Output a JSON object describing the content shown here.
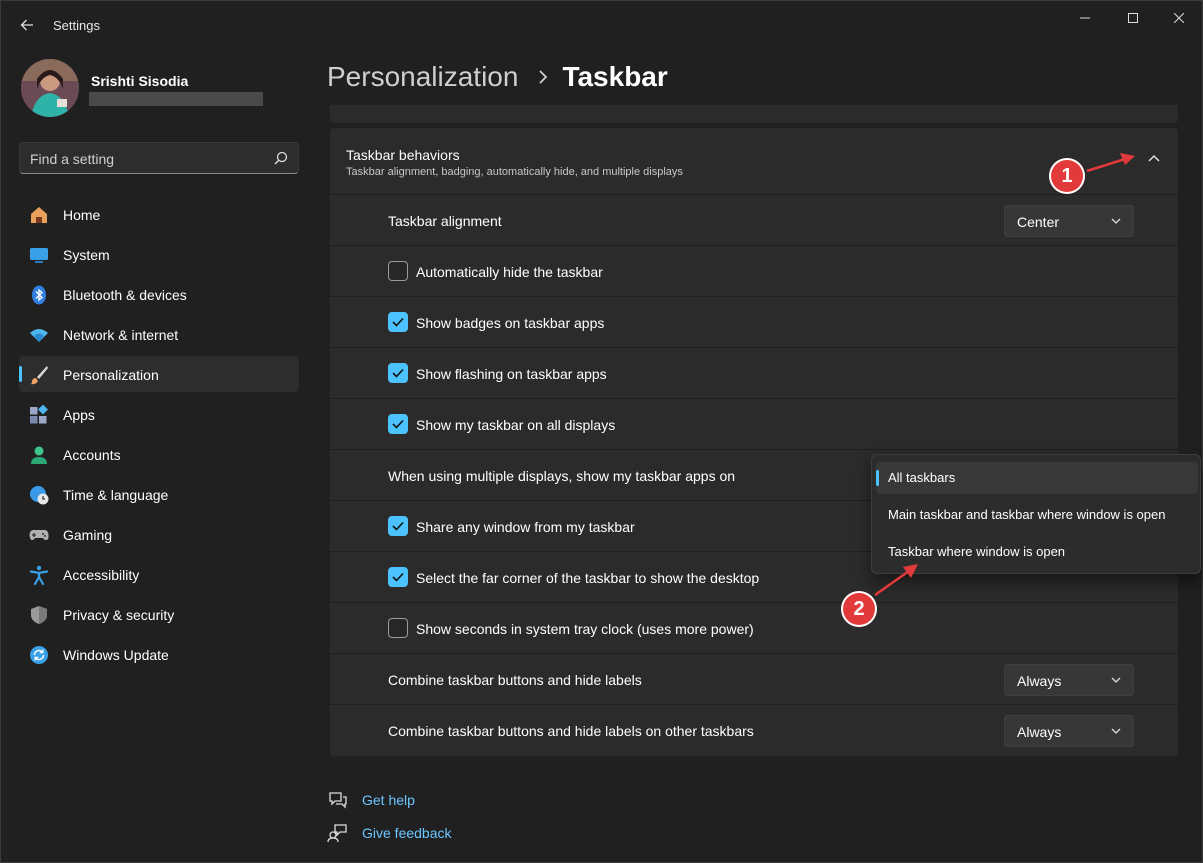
{
  "window": {
    "title": "Settings",
    "back_icon": "arrow-left-icon",
    "controls": [
      "minimize-icon",
      "maximize-icon",
      "close-icon"
    ]
  },
  "profile": {
    "name": "Srishti Sisodia"
  },
  "search": {
    "placeholder": "Find a setting",
    "icon": "search-icon"
  },
  "nav": {
    "items": [
      {
        "label": "Home",
        "icon": "home-icon",
        "color": "#e8a05c"
      },
      {
        "label": "System",
        "icon": "monitor-icon",
        "color": "#3aa0e8"
      },
      {
        "label": "Bluetooth & devices",
        "icon": "bluetooth-icon",
        "color": "#3a8ee8"
      },
      {
        "label": "Network & internet",
        "icon": "wifi-icon",
        "color": "#4fb6f0"
      },
      {
        "label": "Personalization",
        "icon": "brush-icon",
        "color": "#f0a060"
      },
      {
        "label": "Apps",
        "icon": "apps-icon",
        "color": "#9aa7c9"
      },
      {
        "label": "Accounts",
        "icon": "person-icon",
        "color": "#3ec58a"
      },
      {
        "label": "Time & language",
        "icon": "globe-clock-icon",
        "color": "#3a9ae8"
      },
      {
        "label": "Gaming",
        "icon": "gamepad-icon",
        "color": "#b0b0b0"
      },
      {
        "label": "Accessibility",
        "icon": "accessibility-icon",
        "color": "#3aa0e8"
      },
      {
        "label": "Privacy & security",
        "icon": "shield-icon",
        "color": "#9a9a9a"
      },
      {
        "label": "Windows Update",
        "icon": "update-icon",
        "color": "#3aa0e8"
      }
    ],
    "active_index": 4
  },
  "breadcrumb": {
    "parent": "Personalization",
    "separator": ">",
    "current": "Taskbar"
  },
  "section": {
    "title": "Taskbar behaviors",
    "subtitle": "Taskbar alignment, badging, automatically hide, and multiple displays",
    "collapse_icon": "chevron-up-icon"
  },
  "rows": {
    "alignment": {
      "label": "Taskbar alignment",
      "value": "Center"
    },
    "autohide": {
      "label": "Automatically hide the taskbar",
      "checked": false
    },
    "badges": {
      "label": "Show badges on taskbar apps",
      "checked": true
    },
    "flashing": {
      "label": "Show flashing on taskbar apps",
      "checked": true
    },
    "all_displays": {
      "label": "Show my taskbar on all displays",
      "checked": true
    },
    "multi_display": {
      "label": "When using multiple displays, show my taskbar apps on"
    },
    "share_window": {
      "label": "Share any window from my taskbar",
      "checked": true
    },
    "far_corner": {
      "label": "Select the far corner of the taskbar to show the desktop",
      "checked": true
    },
    "seconds": {
      "label": "Show seconds in system tray clock (uses more power)",
      "checked": false
    },
    "combine": {
      "label": "Combine taskbar buttons and hide labels",
      "value": "Always"
    },
    "combine_other": {
      "label": "Combine taskbar buttons and hide labels on other taskbars",
      "value": "Always"
    }
  },
  "flyout": {
    "options": [
      "All taskbars",
      "Main taskbar and taskbar where window is open",
      "Taskbar where window is open"
    ],
    "selected_index": 0
  },
  "footer": {
    "help": {
      "label": "Get help",
      "icon": "help-icon"
    },
    "feedback": {
      "label": "Give feedback",
      "icon": "feedback-icon"
    }
  },
  "annotations": {
    "marker1": "1",
    "marker2": "2",
    "color": "#e23a3a"
  },
  "colors": {
    "accent": "#4cc2ff",
    "background": "#202020",
    "card": "#2b2b2b"
  }
}
